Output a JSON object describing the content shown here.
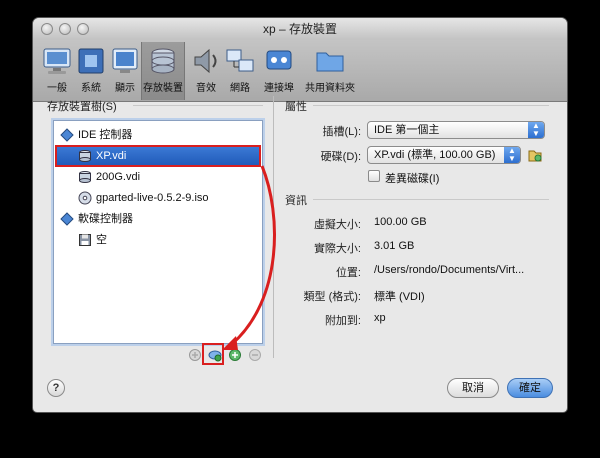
{
  "window": {
    "title": "xp – 存放裝置"
  },
  "toolbar": {
    "items": [
      {
        "label": "一般",
        "icon": "monitor-icon",
        "selected": false
      },
      {
        "label": "系統",
        "icon": "chip-icon",
        "selected": false
      },
      {
        "label": "顯示",
        "icon": "display-icon",
        "selected": false
      },
      {
        "label": "存放裝置",
        "icon": "storage-icon",
        "selected": true
      },
      {
        "label": "音效",
        "icon": "speaker-icon",
        "selected": false
      },
      {
        "label": "網路",
        "icon": "network-icon",
        "selected": false
      },
      {
        "label": "連接埠",
        "icon": "port-icon",
        "selected": false
      },
      {
        "label": "共用資料夾",
        "icon": "folder-icon",
        "selected": false
      }
    ]
  },
  "storage_tree": {
    "heading": "存放裝置樹(S)",
    "items": [
      {
        "label": "IDE 控制器",
        "icon": "ide-controller-icon",
        "level": 0,
        "selected": false
      },
      {
        "label": "XP.vdi",
        "icon": "hard-disk-icon",
        "level": 1,
        "selected": true
      },
      {
        "label": "200G.vdi",
        "icon": "hard-disk-icon",
        "level": 1,
        "selected": false
      },
      {
        "label": "gparted-live-0.5.2-9.iso",
        "icon": "cd-disc-icon",
        "level": 1,
        "selected": false
      },
      {
        "label": "軟碟控制器",
        "icon": "floppy-controller-icon",
        "level": 0,
        "selected": false
      },
      {
        "label": "空",
        "icon": "floppy-disk-icon",
        "level": 1,
        "selected": false
      }
    ],
    "buttons": [
      "add-controller-icon",
      "add-attachment-icon",
      "add-hard-disk-icon",
      "remove-icon"
    ]
  },
  "attributes": {
    "heading": "屬性",
    "slot_label": "插槽(L):",
    "slot_value": "IDE 第一個主",
    "disk_label": "硬碟(D):",
    "disk_value": "XP.vdi (標準, 100.00 GB)",
    "differencing_label": "差異磁碟(I)",
    "differencing_checked": false
  },
  "info": {
    "heading": "資訊",
    "rows": [
      {
        "label": "虛擬大小:",
        "value": "100.00 GB"
      },
      {
        "label": "實際大小:",
        "value": "3.01 GB"
      },
      {
        "label": "位置:",
        "value": "/Users/rondo/Documents/Virt..."
      },
      {
        "label": "類型 (格式):",
        "value": "標準 (VDI)"
      },
      {
        "label": "附加到:",
        "value": "xp"
      }
    ]
  },
  "footer": {
    "help": "?",
    "cancel": "取消",
    "ok": "確定"
  },
  "colors": {
    "selection": "#2a64c4",
    "annotation": "#d91f1f"
  }
}
